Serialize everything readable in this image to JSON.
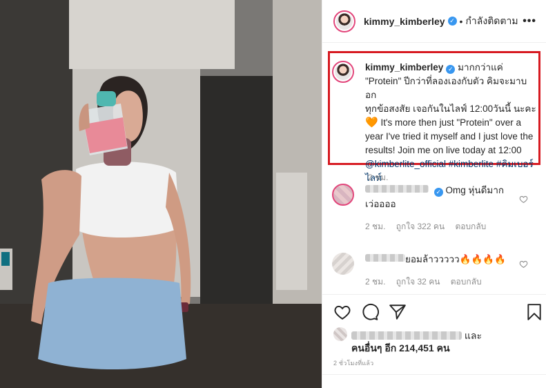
{
  "post": {
    "username": "kimmy_kimberley",
    "dot": "•",
    "follow_label": "กำลังติดตาม",
    "more_label": "•••",
    "verified_icon": "verified-badge-icon"
  },
  "caption": {
    "username": "kimmy_kimberley",
    "text_thai_1": "มากกว่าแค่",
    "text_thai_2": "\"Protein\" ปีกว่าที่ลองเองกับตัว คิมจะมาบอก",
    "text_thai_3": "ทุกข้อสงสัย เจอกันในไลฟ์ 12:00วันนี้ นะคะ",
    "heart": "🧡",
    "text_en": "It's more then just \"Protein\" over a year I've tried it myself and I just love the results! Join me on live today at 12:00",
    "mention": "@kimberlite_official",
    "tag1": "#kimberlite",
    "tag2": "#คิมเบอร์ไลท์",
    "time": "2 ชม."
  },
  "comments": [
    {
      "text": "Omg หุ่นดีมาก",
      "text2": "เว่ออออ",
      "time": "2 ชม.",
      "likes": "ถูกใจ 322 คน",
      "reply": "ตอบกลับ"
    },
    {
      "text": "ยอมล้าววววว🔥🔥🔥🔥",
      "time": "2 ชม.",
      "likes": "ถูกใจ 32 คน",
      "reply": "ตอบกลับ"
    }
  ],
  "likes": {
    "and_label": "และ",
    "others": "คนอื่นๆ อีก 214,451 คน",
    "ago": "2 ชั่วโมงที่แล้ว"
  },
  "colors": {
    "highlight_box": "#d71a21",
    "link": "#003569",
    "verified": "#3897f0",
    "muted": "#8e8e8e"
  }
}
